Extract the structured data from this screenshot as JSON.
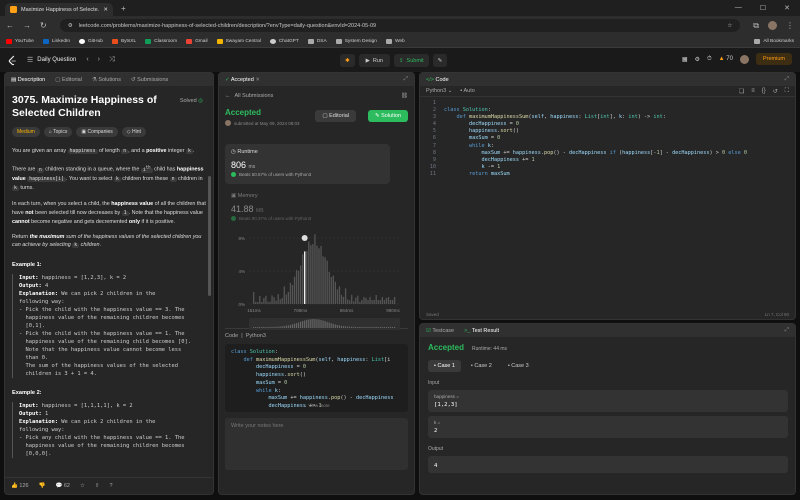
{
  "browser": {
    "tab_title": "Maximize Happiness of Selecte...",
    "url": "leetcode.com/problems/maximize-happiness-of-selected-children/description/?envType=daily-question&envId=2024-05-09",
    "bookmarks": [
      {
        "label": "YouTube",
        "color": "#ff0000"
      },
      {
        "label": "LinkedIn",
        "color": "#0a66c2"
      },
      {
        "label": "GitHub",
        "color": "#ffffff"
      },
      {
        "label": "BytsXL",
        "color": "#e94f1d"
      },
      {
        "label": "Classroom",
        "color": "#0f9d58"
      },
      {
        "label": "Gmail",
        "color": "#ea4335"
      },
      {
        "label": "Swayam Central",
        "color": "#f4b400"
      },
      {
        "label": "ChatGPT",
        "color": "#cccccc"
      },
      {
        "label": "DSA",
        "color": "#aaaaaa"
      },
      {
        "label": "System Design",
        "color": "#aaaaaa"
      },
      {
        "label": "Web",
        "color": "#aaaaaa"
      }
    ],
    "all_bookmarks": "All Bookmarks"
  },
  "topbar": {
    "daily_question": "Daily Question",
    "run": "Run",
    "submit": "Submit",
    "streak": "70",
    "premium": "Premium"
  },
  "desc_panel": {
    "tabs": [
      "Description",
      "Editorial",
      "Solutions",
      "Submissions"
    ],
    "title": "3075. Maximize Happiness of Selected Children",
    "solved": "Solved",
    "tags": [
      "Medium",
      "Topics",
      "Companies",
      "Hint"
    ],
    "footer": {
      "likes": "126",
      "comments": "62"
    }
  },
  "accepted_panel": {
    "tab": "Accepted",
    "all_submissions": "All Submissions",
    "status": "Accepted",
    "submitted_at": "submitted at May 09, 2024 08:03",
    "editorial": "Editorial",
    "solution": "Solution",
    "runtime_label": "Runtime",
    "runtime_value": "806",
    "runtime_unit": "ms",
    "runtime_beats": "Beats 50.57% of users with Python3",
    "memory_label": "Memory",
    "memory_value": "41.88",
    "memory_unit": "MB",
    "memory_beats": "Beats 90.37% of users with Python3",
    "chart_ticks_y": [
      "8%",
      "4%",
      "0%"
    ],
    "chart_ticks_x": [
      "151ms",
      "708ms",
      "864ms",
      "990ms"
    ],
    "code_header": "Code",
    "code_lang": "Python3",
    "view_more": "View more",
    "notes_placeholder": "Write your notes here"
  },
  "code_panel": {
    "title": "Code",
    "lang": "Python3",
    "auto": "Auto",
    "saved": "Saved",
    "cursor": "Ln 7, Col 90"
  },
  "test_panel": {
    "tabs": [
      "Testcase",
      "Test Result"
    ],
    "status": "Accepted",
    "runtime": "Runtime: 44 ms",
    "cases": [
      "Case 1",
      "Case 2",
      "Case 3"
    ],
    "input_label": "Input",
    "happiness_label": "happiness =",
    "happiness_value": "[1,2,3]",
    "k_label": "k =",
    "k_value": "2",
    "output_label": "Output",
    "output_value": "4"
  }
}
